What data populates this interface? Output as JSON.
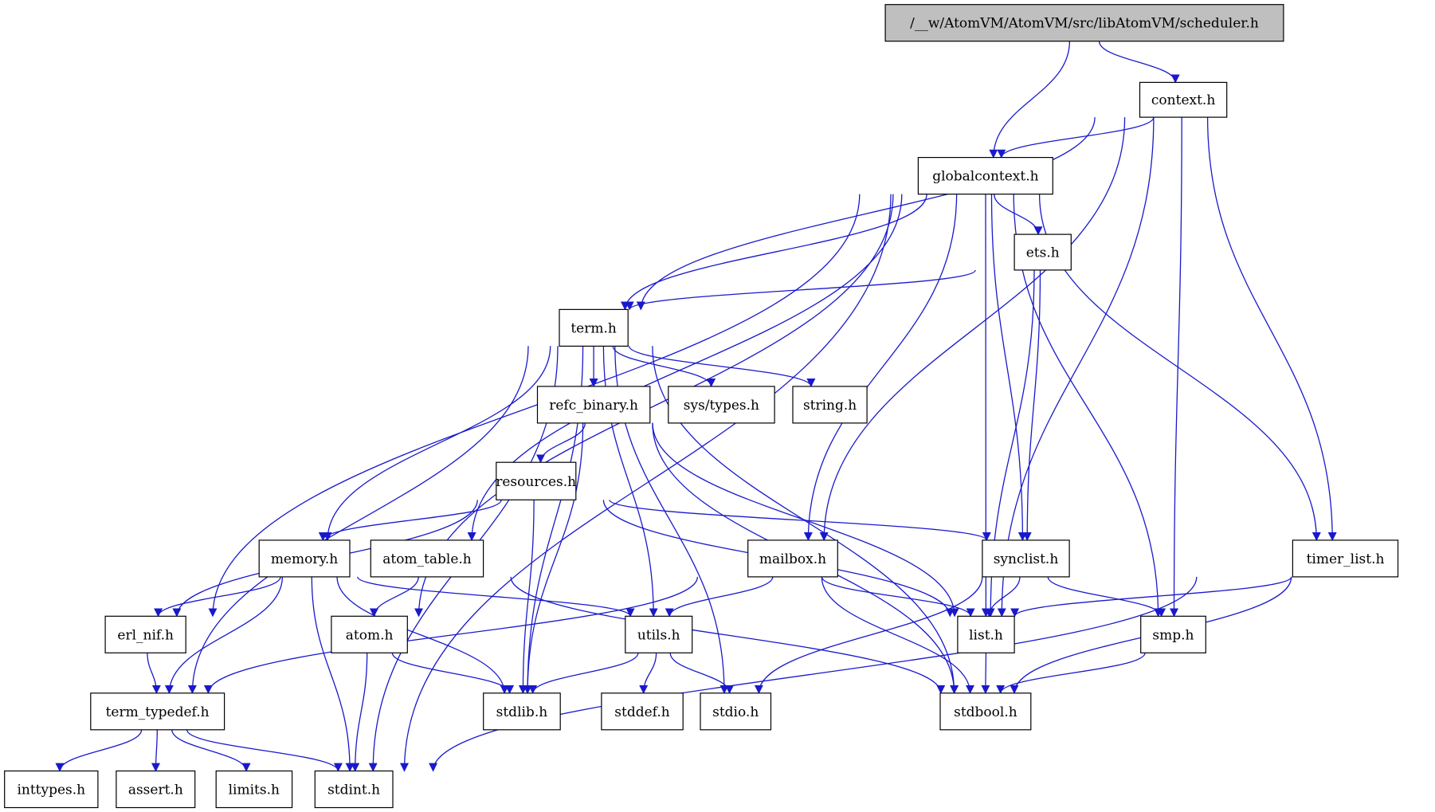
{
  "graph": {
    "title": "/__w/AtomVM/AtomVM/src/libAtomVM/scheduler.h",
    "edge_color": "#1919cc",
    "root_fill": "#bfbfbf",
    "nodes": [
      {
        "id": "scheduler",
        "label": "/__w/AtomVM/AtomVM/src/libAtomVM/scheduler.h",
        "root": true
      },
      {
        "id": "context",
        "label": "context.h"
      },
      {
        "id": "globalcontext",
        "label": "globalcontext.h"
      },
      {
        "id": "ets",
        "label": "ets.h"
      },
      {
        "id": "term",
        "label": "term.h"
      },
      {
        "id": "refc_binary",
        "label": "refc_binary.h"
      },
      {
        "id": "sys_types",
        "label": "sys/types.h"
      },
      {
        "id": "string",
        "label": "string.h"
      },
      {
        "id": "resources",
        "label": "resources.h"
      },
      {
        "id": "memory",
        "label": "memory.h"
      },
      {
        "id": "atom_table",
        "label": "atom_table.h"
      },
      {
        "id": "mailbox",
        "label": "mailbox.h"
      },
      {
        "id": "synclist",
        "label": "synclist.h"
      },
      {
        "id": "timer_list",
        "label": "timer_list.h"
      },
      {
        "id": "erl_nif",
        "label": "erl_nif.h"
      },
      {
        "id": "atom",
        "label": "atom.h"
      },
      {
        "id": "utils",
        "label": "utils.h"
      },
      {
        "id": "list",
        "label": "list.h"
      },
      {
        "id": "smp",
        "label": "smp.h"
      },
      {
        "id": "term_typedef",
        "label": "term_typedef.h"
      },
      {
        "id": "stdlib",
        "label": "stdlib.h"
      },
      {
        "id": "stddef",
        "label": "stddef.h"
      },
      {
        "id": "stdio",
        "label": "stdio.h"
      },
      {
        "id": "stdbool",
        "label": "stdbool.h"
      },
      {
        "id": "inttypes",
        "label": "inttypes.h"
      },
      {
        "id": "assert",
        "label": "assert.h"
      },
      {
        "id": "limits",
        "label": "limits.h"
      },
      {
        "id": "stdint",
        "label": "stdint.h"
      }
    ],
    "edges": [
      [
        "scheduler",
        "context"
      ],
      [
        "scheduler",
        "globalcontext"
      ],
      [
        "context",
        "globalcontext"
      ],
      [
        "context",
        "term"
      ],
      [
        "context",
        "mailbox"
      ],
      [
        "context",
        "list"
      ],
      [
        "context",
        "smp"
      ],
      [
        "context",
        "timer_list"
      ],
      [
        "globalcontext",
        "term"
      ],
      [
        "globalcontext",
        "ets"
      ],
      [
        "globalcontext",
        "erl_nif"
      ],
      [
        "globalcontext",
        "atom"
      ],
      [
        "globalcontext",
        "atom_table"
      ],
      [
        "globalcontext",
        "mailbox"
      ],
      [
        "globalcontext",
        "list"
      ],
      [
        "globalcontext",
        "synclist"
      ],
      [
        "globalcontext",
        "smp"
      ],
      [
        "globalcontext",
        "timer_list"
      ],
      [
        "globalcontext",
        "stdint"
      ],
      [
        "ets",
        "term"
      ],
      [
        "ets",
        "synclist"
      ],
      [
        "ets",
        "list"
      ],
      [
        "term",
        "refc_binary"
      ],
      [
        "term",
        "sys_types"
      ],
      [
        "term",
        "string"
      ],
      [
        "term",
        "memory"
      ],
      [
        "term",
        "term_typedef"
      ],
      [
        "term",
        "stdint"
      ],
      [
        "term",
        "stdlib"
      ],
      [
        "term",
        "utils"
      ],
      [
        "term",
        "stdio"
      ],
      [
        "term",
        "stdbool"
      ],
      [
        "refc_binary",
        "resources"
      ],
      [
        "refc_binary",
        "stdlib"
      ],
      [
        "refc_binary",
        "list"
      ],
      [
        "refc_binary",
        "stdbool"
      ],
      [
        "resources",
        "memory"
      ],
      [
        "resources",
        "erl_nif"
      ],
      [
        "resources",
        "stdlib"
      ],
      [
        "resources",
        "synclist"
      ],
      [
        "resources",
        "list"
      ],
      [
        "memory",
        "erl_nif"
      ],
      [
        "memory",
        "term_typedef"
      ],
      [
        "memory",
        "stdint"
      ],
      [
        "memory",
        "stdlib"
      ],
      [
        "memory",
        "utils"
      ],
      [
        "atom_table",
        "atom"
      ],
      [
        "atom_table",
        "stdbool"
      ],
      [
        "mailbox",
        "term_typedef"
      ],
      [
        "mailbox",
        "utils"
      ],
      [
        "mailbox",
        "list"
      ],
      [
        "mailbox",
        "stdbool"
      ],
      [
        "synclist",
        "list"
      ],
      [
        "synclist",
        "smp"
      ],
      [
        "synclist",
        "stdio"
      ],
      [
        "timer_list",
        "list"
      ],
      [
        "timer_list",
        "stdbool"
      ],
      [
        "timer_list",
        "stdint"
      ],
      [
        "erl_nif",
        "term_typedef"
      ],
      [
        "atom",
        "stdlib"
      ],
      [
        "atom",
        "stdint"
      ],
      [
        "utils",
        "stdlib"
      ],
      [
        "utils",
        "stddef"
      ],
      [
        "utils",
        "stdio"
      ],
      [
        "list",
        "stdbool"
      ],
      [
        "smp",
        "stdbool"
      ],
      [
        "term_typedef",
        "inttypes"
      ],
      [
        "term_typedef",
        "assert"
      ],
      [
        "term_typedef",
        "limits"
      ],
      [
        "term_typedef",
        "stdint"
      ]
    ]
  }
}
